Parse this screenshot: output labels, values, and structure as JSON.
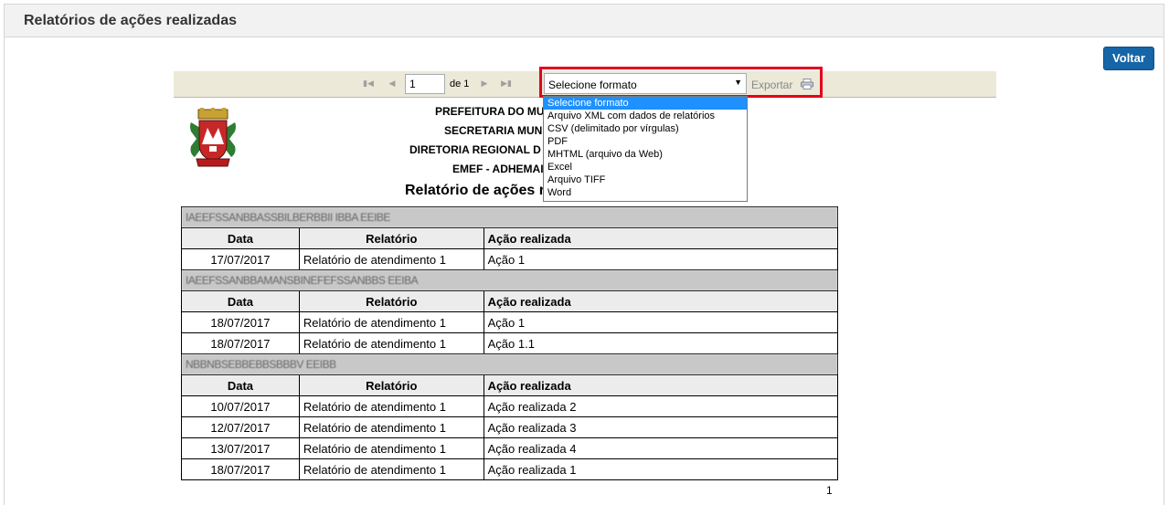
{
  "panel": {
    "title": "Relatórios de ações realizadas"
  },
  "buttons": {
    "back_label": "Voltar"
  },
  "toolbar": {
    "current_page": "1",
    "page_of_label": "de 1",
    "format_selected": "Selecione formato",
    "export_label": "Exportar",
    "format_options": [
      "Selecione formato",
      "Arquivo XML com dados de relatórios",
      "CSV (delimitado por vírgulas)",
      "PDF",
      "MHTML (arquivo da Web)",
      "Excel",
      "Arquivo TIFF",
      "Word"
    ]
  },
  "report": {
    "header_lines": [
      "PREFEITURA DO MU",
      "SECRETARIA MUN",
      "DIRETORIA REGIONAL D",
      "EMEF - ADHEMAI"
    ],
    "title": "Relatório de ações r",
    "columns": [
      "Data",
      "Relatório",
      "Ação realizada"
    ],
    "groups": [
      {
        "name": "IAEEFSSANBBASSBILBERBBII IBBA EEIBE",
        "rows": [
          [
            "17/07/2017",
            "Relatório de atendimento 1",
            "Ação 1"
          ]
        ]
      },
      {
        "name": "IAEEFSSANBBAMANSBINEFEFSSANBBS EEIBA",
        "rows": [
          [
            "18/07/2017",
            "Relatório de atendimento 1",
            "Ação 1"
          ],
          [
            "18/07/2017",
            "Relatório de atendimento 1",
            "Ação 1.1"
          ]
        ]
      },
      {
        "name": "NBBNBSEBBEBBSBBBV EEIBB",
        "rows": [
          [
            "10/07/2017",
            "Relatório de atendimento 1",
            "Ação realizada 2"
          ],
          [
            "12/07/2017",
            "Relatório de atendimento 1",
            "Ação realizada 3"
          ],
          [
            "13/07/2017",
            "Relatório de atendimento 1",
            "Ação realizada 4"
          ],
          [
            "18/07/2017",
            "Relatório de atendimento 1",
            "Ação realizada 1"
          ]
        ]
      }
    ],
    "page_number": "1"
  },
  "icons": {
    "first": "first-page-icon",
    "prev": "prev-page-icon",
    "next": "next-page-icon",
    "last": "last-page-icon",
    "print": "print-icon",
    "logo": "city-coat-of-arms"
  },
  "colors": {
    "accent": "#1565a7",
    "highlight": "#e4001b",
    "dropdown_selected": "#1e90ff",
    "toolbar_bg": "#ece9d8"
  }
}
